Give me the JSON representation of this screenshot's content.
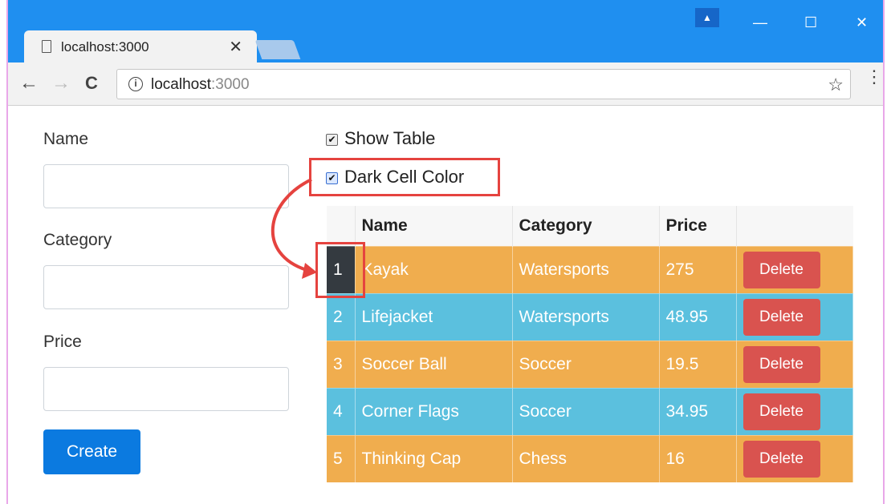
{
  "browser": {
    "tab_title": "localhost:3000",
    "tab_close": "✕",
    "url_host": "localhost",
    "url_port": ":3000",
    "back": "←",
    "forward": "→",
    "reload": "C",
    "star": "☆",
    "menu": "⋮",
    "minimize": "—",
    "maximize": "☐",
    "close": "✕",
    "info": "i"
  },
  "form": {
    "name_label": "Name",
    "category_label": "Category",
    "price_label": "Price",
    "create_label": "Create"
  },
  "options": {
    "show_table_label": "Show Table",
    "dark_cell_label": "Dark Cell Color",
    "show_table_checked": true,
    "dark_cell_checked": true
  },
  "table": {
    "headers": [
      "",
      "Name",
      "Category",
      "Price",
      ""
    ],
    "rows": [
      {
        "index": "1",
        "name": "Kayak",
        "category": "Watersports",
        "price": "275",
        "action": "Delete"
      },
      {
        "index": "2",
        "name": "Lifejacket",
        "category": "Watersports",
        "price": "48.95",
        "action": "Delete"
      },
      {
        "index": "3",
        "name": "Soccer Ball",
        "category": "Soccer",
        "price": "19.5",
        "action": "Delete"
      },
      {
        "index": "4",
        "name": "Corner Flags",
        "category": "Soccer",
        "price": "34.95",
        "action": "Delete"
      },
      {
        "index": "5",
        "name": "Thinking Cap",
        "category": "Chess",
        "price": "16",
        "action": "Delete"
      }
    ]
  },
  "colors": {
    "row_warning": "#f0ad4e",
    "row_info": "#5bc0de",
    "dark_cell": "#343a40",
    "delete_button": "#d9534f",
    "create_button": "#0b7ae0",
    "annotation": "#e5433f"
  }
}
